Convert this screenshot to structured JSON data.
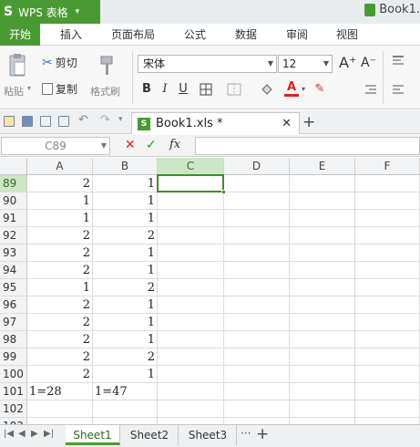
{
  "app": {
    "logo": "S",
    "name": "WPS 表格",
    "caret": "▾"
  },
  "window": {
    "doc_title": "Book1."
  },
  "menu": {
    "tabs": [
      "开始",
      "插入",
      "页面布局",
      "公式",
      "数据",
      "审阅",
      "视图"
    ],
    "active": "开始"
  },
  "ribbon": {
    "paste_label": "粘贴",
    "cut_label": "剪切",
    "copy_label": "复制",
    "format_painter_label": "格式刷",
    "font_name": "宋体",
    "font_size": "12",
    "bold": "B",
    "italic": "I",
    "underline": "U",
    "grow_font": "A⁺",
    "shrink_font": "A⁻",
    "font_color": "A"
  },
  "doc_tabs": {
    "active_file": "Book1.xls *",
    "close": "✕",
    "add": "+"
  },
  "formula_bar": {
    "name_box": "C89",
    "cancel": "✕",
    "confirm": "✓",
    "fx": "fx",
    "formula": ""
  },
  "grid": {
    "columns": [
      "A",
      "B",
      "C",
      "D",
      "E",
      "F"
    ],
    "selected_column": "C",
    "selected_row": "89",
    "rows": [
      {
        "n": "89",
        "a": "2",
        "b": "1"
      },
      {
        "n": "90",
        "a": "1",
        "b": "1"
      },
      {
        "n": "91",
        "a": "1",
        "b": "1"
      },
      {
        "n": "92",
        "a": "2",
        "b": "2"
      },
      {
        "n": "93",
        "a": "2",
        "b": "1"
      },
      {
        "n": "94",
        "a": "2",
        "b": "1"
      },
      {
        "n": "95",
        "a": "1",
        "b": "2"
      },
      {
        "n": "96",
        "a": "2",
        "b": "1"
      },
      {
        "n": "97",
        "a": "2",
        "b": "1"
      },
      {
        "n": "98",
        "a": "2",
        "b": "1"
      },
      {
        "n": "99",
        "a": "2",
        "b": "2"
      },
      {
        "n": "100",
        "a": "2",
        "b": "1"
      },
      {
        "n": "101",
        "a": "1=28",
        "b": "1=47"
      },
      {
        "n": "102",
        "a": "",
        "b": ""
      },
      {
        "n": "103",
        "a": "",
        "b": ""
      }
    ]
  },
  "sheets": {
    "tabs": [
      "Sheet1",
      "Sheet2",
      "Sheet3"
    ],
    "active": "Sheet1",
    "more": "···",
    "add": "+"
  },
  "colors": {
    "accent": "#4a9a33",
    "selection": "#3d8f2b",
    "header_highlight": "#cfe6c6"
  }
}
